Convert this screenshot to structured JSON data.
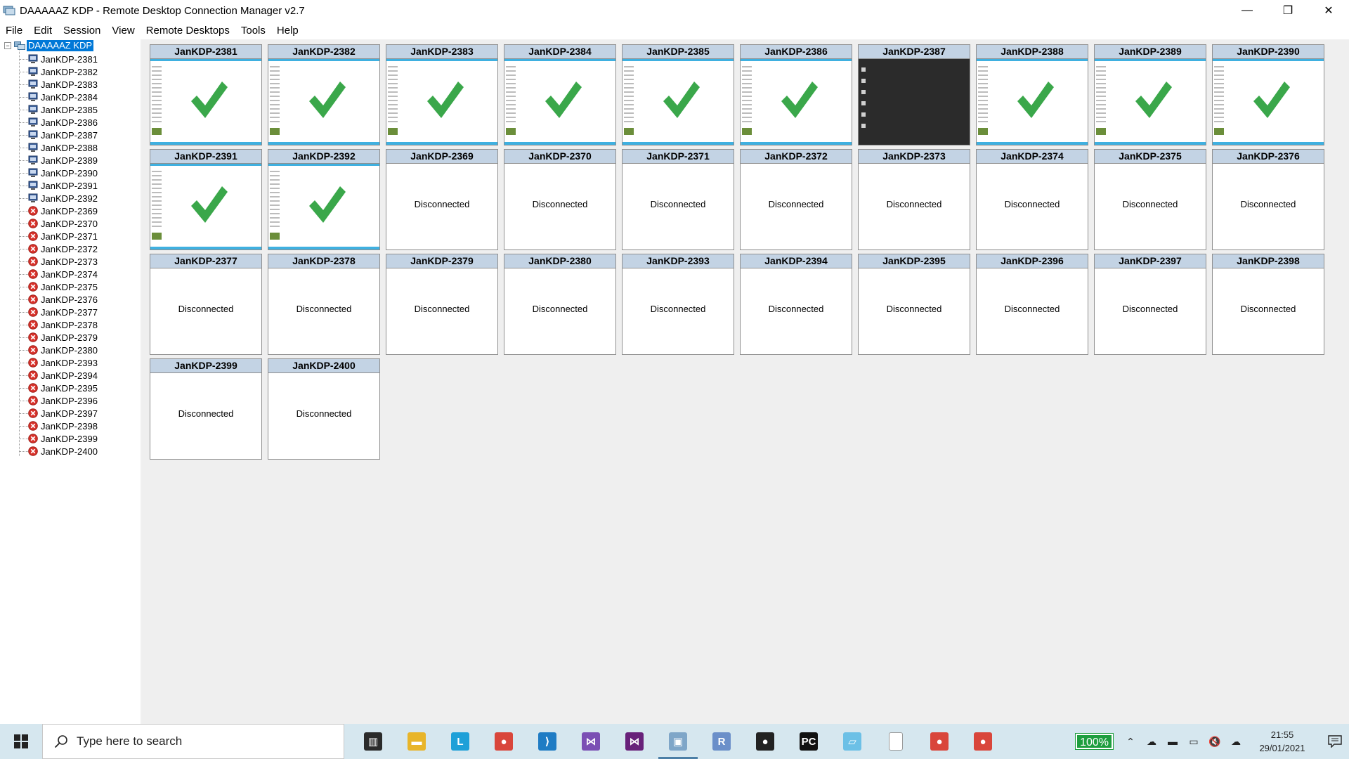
{
  "window": {
    "title": "DAAAAAZ KDP - Remote Desktop Connection Manager v2.7",
    "minimize": "—",
    "maximize": "❐",
    "close": "✕"
  },
  "menu": [
    "File",
    "Edit",
    "Session",
    "View",
    "Remote Desktops",
    "Tools",
    "Help"
  ],
  "tree": {
    "root_label": "DAAAAAZ KDP",
    "expander": "−",
    "nodes": [
      {
        "label": "JanKDP-2381",
        "status": "connected"
      },
      {
        "label": "JanKDP-2382",
        "status": "connected"
      },
      {
        "label": "JanKDP-2383",
        "status": "connected"
      },
      {
        "label": "JanKDP-2384",
        "status": "connected"
      },
      {
        "label": "JanKDP-2385",
        "status": "connected"
      },
      {
        "label": "JanKDP-2386",
        "status": "connected"
      },
      {
        "label": "JanKDP-2387",
        "status": "connected"
      },
      {
        "label": "JanKDP-2388",
        "status": "connected"
      },
      {
        "label": "JanKDP-2389",
        "status": "connected"
      },
      {
        "label": "JanKDP-2390",
        "status": "connected"
      },
      {
        "label": "JanKDP-2391",
        "status": "connected"
      },
      {
        "label": "JanKDP-2392",
        "status": "connected"
      },
      {
        "label": "JanKDP-2369",
        "status": "disconnected"
      },
      {
        "label": "JanKDP-2370",
        "status": "disconnected"
      },
      {
        "label": "JanKDP-2371",
        "status": "disconnected"
      },
      {
        "label": "JanKDP-2372",
        "status": "disconnected"
      },
      {
        "label": "JanKDP-2373",
        "status": "disconnected"
      },
      {
        "label": "JanKDP-2374",
        "status": "disconnected"
      },
      {
        "label": "JanKDP-2375",
        "status": "disconnected"
      },
      {
        "label": "JanKDP-2376",
        "status": "disconnected"
      },
      {
        "label": "JanKDP-2377",
        "status": "disconnected"
      },
      {
        "label": "JanKDP-2378",
        "status": "disconnected"
      },
      {
        "label": "JanKDP-2379",
        "status": "disconnected"
      },
      {
        "label": "JanKDP-2380",
        "status": "disconnected"
      },
      {
        "label": "JanKDP-2393",
        "status": "disconnected"
      },
      {
        "label": "JanKDP-2394",
        "status": "disconnected"
      },
      {
        "label": "JanKDP-2395",
        "status": "disconnected"
      },
      {
        "label": "JanKDP-2396",
        "status": "disconnected"
      },
      {
        "label": "JanKDP-2397",
        "status": "disconnected"
      },
      {
        "label": "JanKDP-2398",
        "status": "disconnected"
      },
      {
        "label": "JanKDP-2399",
        "status": "disconnected"
      },
      {
        "label": "JanKDP-2400",
        "status": "disconnected"
      }
    ]
  },
  "thumbnails": [
    {
      "name": "JanKDP-2381",
      "state": "connected-check"
    },
    {
      "name": "JanKDP-2382",
      "state": "connected-check"
    },
    {
      "name": "JanKDP-2383",
      "state": "connected-check"
    },
    {
      "name": "JanKDP-2384",
      "state": "connected-check"
    },
    {
      "name": "JanKDP-2385",
      "state": "connected-check"
    },
    {
      "name": "JanKDP-2386",
      "state": "connected-check"
    },
    {
      "name": "JanKDP-2387",
      "state": "connected-dark"
    },
    {
      "name": "JanKDP-2388",
      "state": "connected-check"
    },
    {
      "name": "JanKDP-2389",
      "state": "connected-check"
    },
    {
      "name": "JanKDP-2390",
      "state": "connected-check"
    },
    {
      "name": "JanKDP-2391",
      "state": "connected-check"
    },
    {
      "name": "JanKDP-2392",
      "state": "connected-check"
    },
    {
      "name": "JanKDP-2369",
      "state": "disconnected",
      "status": "Disconnected"
    },
    {
      "name": "JanKDP-2370",
      "state": "disconnected",
      "status": "Disconnected"
    },
    {
      "name": "JanKDP-2371",
      "state": "disconnected",
      "status": "Disconnected"
    },
    {
      "name": "JanKDP-2372",
      "state": "disconnected",
      "status": "Disconnected"
    },
    {
      "name": "JanKDP-2373",
      "state": "disconnected",
      "status": "Disconnected"
    },
    {
      "name": "JanKDP-2374",
      "state": "disconnected",
      "status": "Disconnected"
    },
    {
      "name": "JanKDP-2375",
      "state": "disconnected",
      "status": "Disconnected"
    },
    {
      "name": "JanKDP-2376",
      "state": "disconnected",
      "status": "Disconnected"
    },
    {
      "name": "JanKDP-2377",
      "state": "disconnected",
      "status": "Disconnected"
    },
    {
      "name": "JanKDP-2378",
      "state": "disconnected",
      "status": "Disconnected"
    },
    {
      "name": "JanKDP-2379",
      "state": "disconnected",
      "status": "Disconnected"
    },
    {
      "name": "JanKDP-2380",
      "state": "disconnected",
      "status": "Disconnected"
    },
    {
      "name": "JanKDP-2393",
      "state": "disconnected",
      "status": "Disconnected"
    },
    {
      "name": "JanKDP-2394",
      "state": "disconnected",
      "status": "Disconnected"
    },
    {
      "name": "JanKDP-2395",
      "state": "disconnected",
      "status": "Disconnected"
    },
    {
      "name": "JanKDP-2396",
      "state": "disconnected",
      "status": "Disconnected"
    },
    {
      "name": "JanKDP-2397",
      "state": "disconnected",
      "status": "Disconnected"
    },
    {
      "name": "JanKDP-2398",
      "state": "disconnected",
      "status": "Disconnected"
    },
    {
      "name": "JanKDP-2399",
      "state": "disconnected",
      "status": "Disconnected"
    },
    {
      "name": "JanKDP-2400",
      "state": "disconnected",
      "status": "Disconnected"
    }
  ],
  "taskbar": {
    "search_placeholder": "Type here to search",
    "apps": [
      {
        "icon": "task-view-icon",
        "color": "#2b2b2b",
        "glyph": "▥",
        "active": false
      },
      {
        "icon": "file-explorer-icon",
        "color": "#e8b52a",
        "glyph": "▬",
        "active": false
      },
      {
        "icon": "l-app-icon",
        "color": "#1ea0d8",
        "glyph": "L",
        "active": false
      },
      {
        "icon": "chrome-icon",
        "color": "#d9463b",
        "glyph": "●",
        "active": false
      },
      {
        "icon": "vscode-icon",
        "color": "#1f7cc4",
        "glyph": "⟩",
        "active": false
      },
      {
        "icon": "visual-studio-icon",
        "color": "#7b4fb4",
        "glyph": "⋈",
        "active": false
      },
      {
        "icon": "visual-studio-alt-icon",
        "color": "#68217a",
        "glyph": "⋈",
        "active": false
      },
      {
        "icon": "rdcman-icon",
        "color": "#7fa6c8",
        "glyph": "▣",
        "active": true
      },
      {
        "icon": "r-icon",
        "color": "#6b8fc9",
        "glyph": "R",
        "active": false
      },
      {
        "icon": "github-icon",
        "color": "#222222",
        "glyph": "●",
        "active": false
      },
      {
        "icon": "pycharm-icon",
        "color": "#111111",
        "glyph": "PC",
        "active": false
      },
      {
        "icon": "notepad-icon",
        "color": "#6cc0e6",
        "glyph": "▱",
        "active": false
      },
      {
        "icon": "blank-file-icon",
        "color": "#ffffff",
        "glyph": "",
        "active": false
      },
      {
        "icon": "chrome-icon-2",
        "color": "#d9463b",
        "glyph": "●",
        "active": false
      },
      {
        "icon": "chrome-icon-3",
        "color": "#d9463b",
        "glyph": "●",
        "active": false
      }
    ],
    "battery": "100%",
    "tray_icons": [
      {
        "icon": "chevron-up-icon",
        "glyph": "⌃"
      },
      {
        "icon": "onedrive-icon",
        "glyph": "☁"
      },
      {
        "icon": "battery-icon",
        "glyph": "▬"
      },
      {
        "icon": "network-icon",
        "glyph": "▭"
      },
      {
        "icon": "volume-muted-icon",
        "glyph": "🔇"
      },
      {
        "icon": "cloud-icon",
        "glyph": "☁"
      }
    ],
    "time": "21:55",
    "date": "29/01/2021"
  }
}
